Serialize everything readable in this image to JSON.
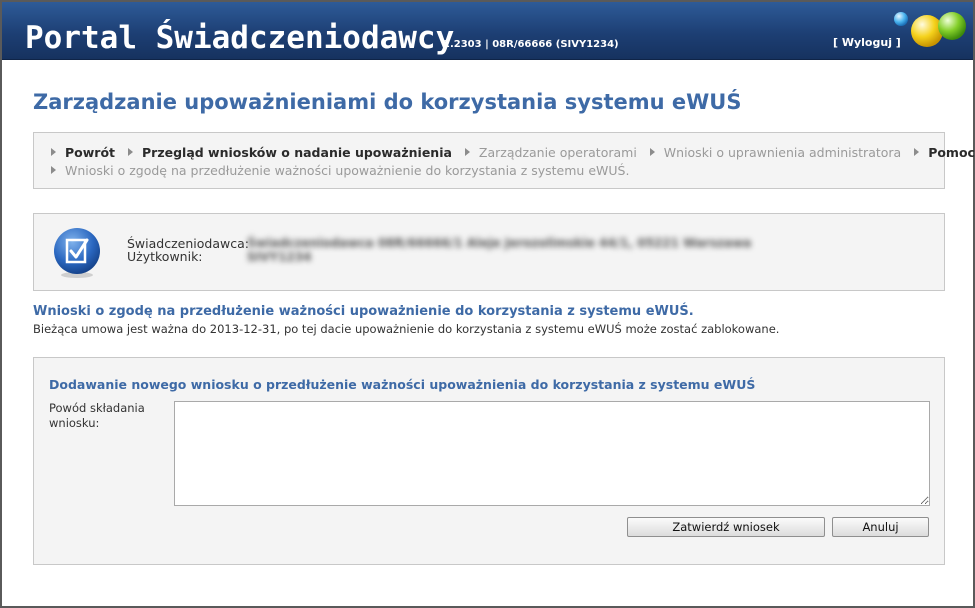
{
  "header": {
    "title": "Portal Świadczeniodawcy",
    "version": "2.2303 | 08R/66666 (SIVY1234)",
    "logout": "[ Wyloguj ]"
  },
  "page_title": "Zarządzanie upoważnieniami do korzystania systemu eWUŚ",
  "nav": {
    "row1": [
      {
        "label": "Powrót",
        "active": true
      },
      {
        "label": "Przegląd wniosków o nadanie upoważnienia",
        "active": true
      },
      {
        "label": "Zarządzanie operatorami",
        "active": false
      },
      {
        "label": "Wnioski o uprawnienia administratora",
        "active": false
      },
      {
        "label": "Pomoc",
        "active": true
      }
    ],
    "row2": [
      {
        "label": "Wnioski o zgodę na przedłużenie ważności upoważnienie do korzystania z systemu eWUŚ.",
        "active": false
      }
    ]
  },
  "info": {
    "provider_label": "Świadczeniodawca:",
    "user_label": "Użytkownik:",
    "provider_value": "Świadczeniodawca 08R/66666/1 Aleje Jerozolimskie 44/1, 05221 Warszawa",
    "user_value": "SIVY1234"
  },
  "section": {
    "heading": "Wnioski o zgodę na przedłużenie ważności upoważnienie do korzystania z systemu eWUŚ.",
    "note": "Bieżąca umowa jest ważna do 2013-12-31, po tej dacie upoważnienie do korzystania z systemu eWUŚ może zostać zablokowane."
  },
  "form": {
    "title": "Dodawanie nowego wniosku o przedłużenie ważności upoważnienia do korzystania z systemu eWUŚ",
    "reason_label": "Powód składania wniosku:",
    "reason_value": "",
    "submit_label": "Zatwierdź wniosek",
    "cancel_label": "Anuluj"
  },
  "colors": {
    "header": "#1d3f74",
    "accent": "#3e6aa6",
    "panel": "#f4f4f4"
  }
}
